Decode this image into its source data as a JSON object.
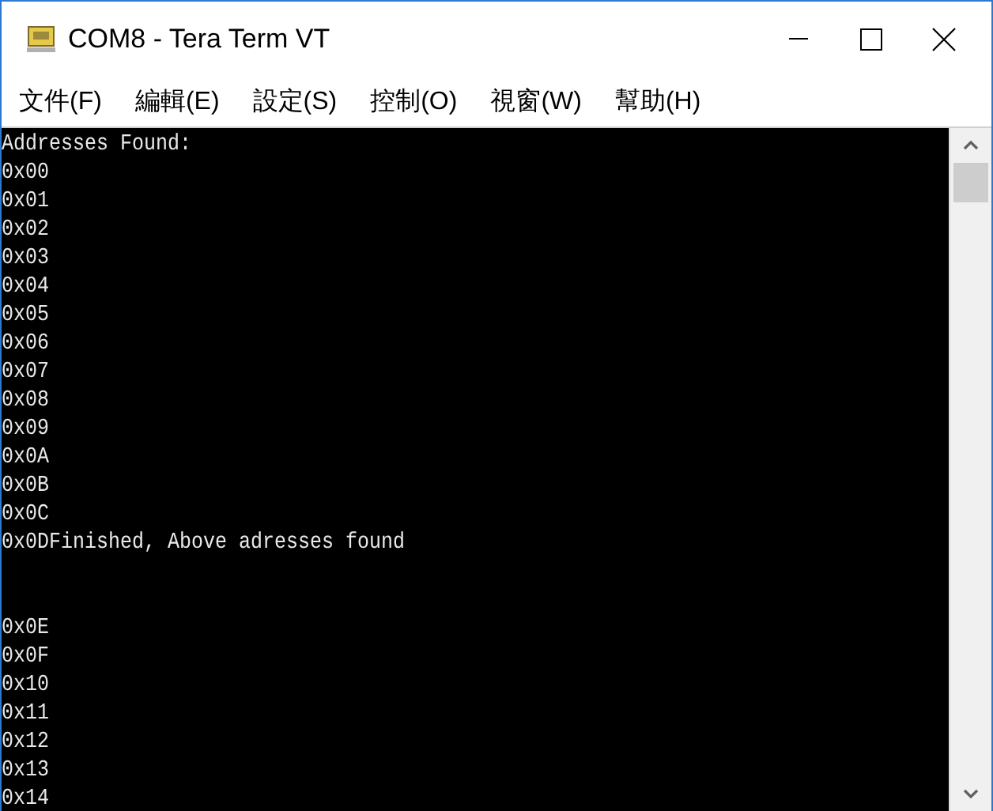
{
  "window": {
    "title": "COM8 - Tera Term VT"
  },
  "menu": [
    {
      "label": "文件(F)"
    },
    {
      "label": "編輯(E)"
    },
    {
      "label": "設定(S)"
    },
    {
      "label": "控制(O)"
    },
    {
      "label": "視窗(W)"
    },
    {
      "label": "幫助(H)"
    }
  ],
  "terminal": {
    "blocks": [
      {
        "lines": [
          "Addresses Found:",
          "0x00",
          "0x01",
          "0x02",
          "0x03",
          "0x04",
          "0x05",
          "0x06",
          "0x07",
          "0x08",
          "0x09",
          "0x0A",
          "0x0B",
          "0x0C",
          "0x0DFinished, Above adresses found"
        ]
      },
      {
        "lines": [
          "0x0E",
          "0x0F",
          "0x10",
          "0x11",
          "0x12",
          "0x13",
          "0x14"
        ]
      }
    ]
  }
}
